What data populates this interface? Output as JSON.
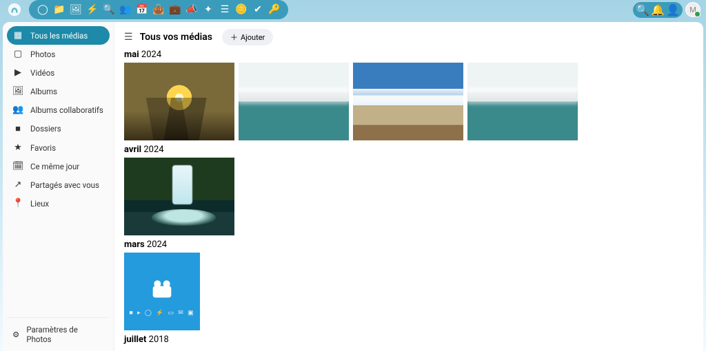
{
  "topbar": {
    "app_icons": [
      "circle",
      "folder",
      "image",
      "bolt",
      "search",
      "users",
      "calendar",
      "bag",
      "briefcase",
      "bullhorn",
      "sparkle",
      "list",
      "coins",
      "check",
      "key"
    ],
    "right_icons": [
      "search",
      "bell",
      "contacts"
    ],
    "avatar_initial": "M"
  },
  "sidebar": {
    "items": [
      {
        "icon": "▦",
        "label": "Tous les médias",
        "active": true
      },
      {
        "icon": "▢",
        "label": "Photos"
      },
      {
        "icon": "▶",
        "label": "Vidéos"
      },
      {
        "icon": "🖼",
        "label": "Albums"
      },
      {
        "icon": "👥",
        "label": "Albums collaboratifs"
      },
      {
        "icon": "■",
        "label": "Dossiers"
      },
      {
        "icon": "★",
        "label": "Favoris"
      },
      {
        "icon": "🗓",
        "label": "Ce même jour"
      },
      {
        "icon": "↗",
        "label": "Partagés avec vous"
      },
      {
        "icon": "📍",
        "label": "Lieux"
      }
    ],
    "settings_label": "Paramètres de Photos"
  },
  "header": {
    "title": "Tous vos médias",
    "add_label": "Ajouter"
  },
  "sections": [
    {
      "month": "mai",
      "year": "2024",
      "thumbs": [
        "sunset",
        "lake",
        "mountain",
        "lake"
      ]
    },
    {
      "month": "avril",
      "year": "2024",
      "thumbs": [
        "waterfall"
      ]
    },
    {
      "month": "mars",
      "year": "2024",
      "thumbs": [
        "video"
      ]
    },
    {
      "month": "juillet",
      "year": "2018",
      "thumbs": []
    }
  ]
}
